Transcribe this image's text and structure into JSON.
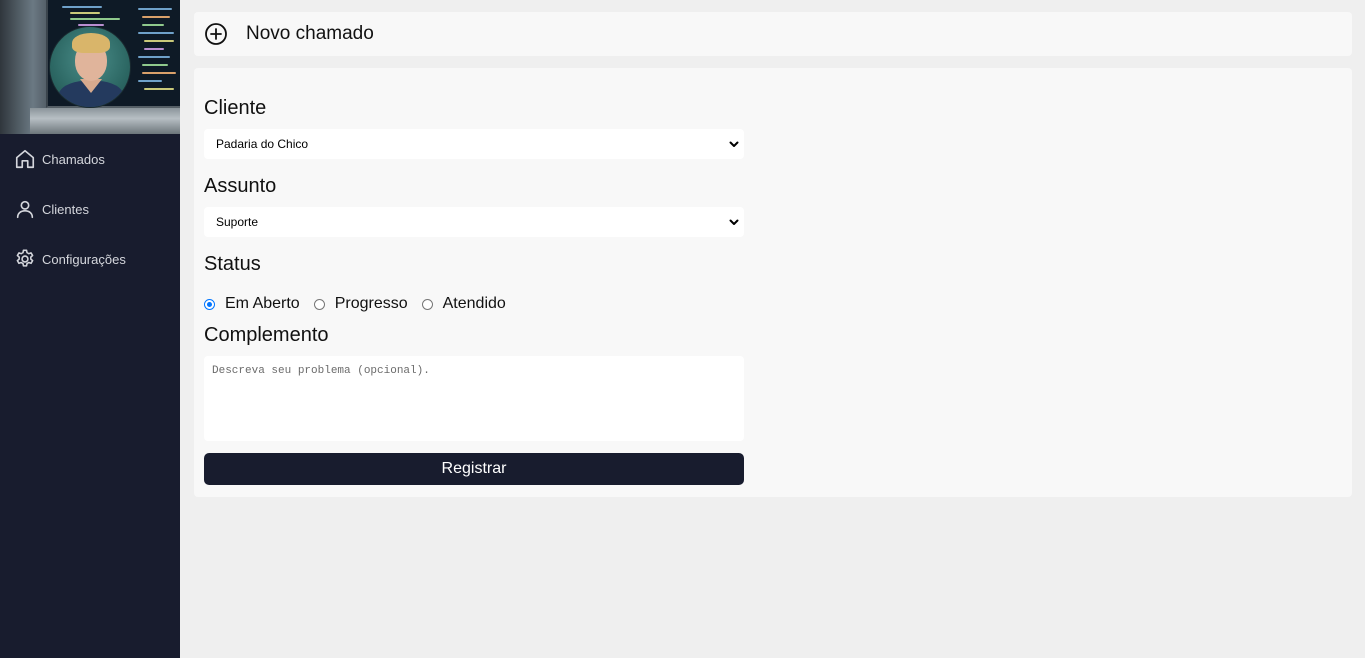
{
  "sidebar": {
    "items": [
      {
        "label": "Chamados",
        "icon": "home-icon"
      },
      {
        "label": "Clientes",
        "icon": "user-icon"
      },
      {
        "label": "Configurações",
        "icon": "gear-icon"
      }
    ]
  },
  "header": {
    "title": "Novo chamado",
    "icon": "plus-circle-icon"
  },
  "form": {
    "cliente_label": "Cliente",
    "cliente_value": "Padaria do Chico",
    "assunto_label": "Assunto",
    "assunto_value": "Suporte",
    "status_label": "Status",
    "status_options": [
      "Em Aberto",
      "Progresso",
      "Atendido"
    ],
    "status_selected": "Em Aberto",
    "complemento_label": "Complemento",
    "complemento_placeholder": "Descreva seu problema (opcional).",
    "submit_label": "Registrar"
  },
  "colors": {
    "sidebar_bg": "#181c2e",
    "page_bg": "#efefef",
    "card_bg": "#f8f8f8",
    "button_bg": "#181c2e",
    "radio_accent": "#0075ff"
  }
}
